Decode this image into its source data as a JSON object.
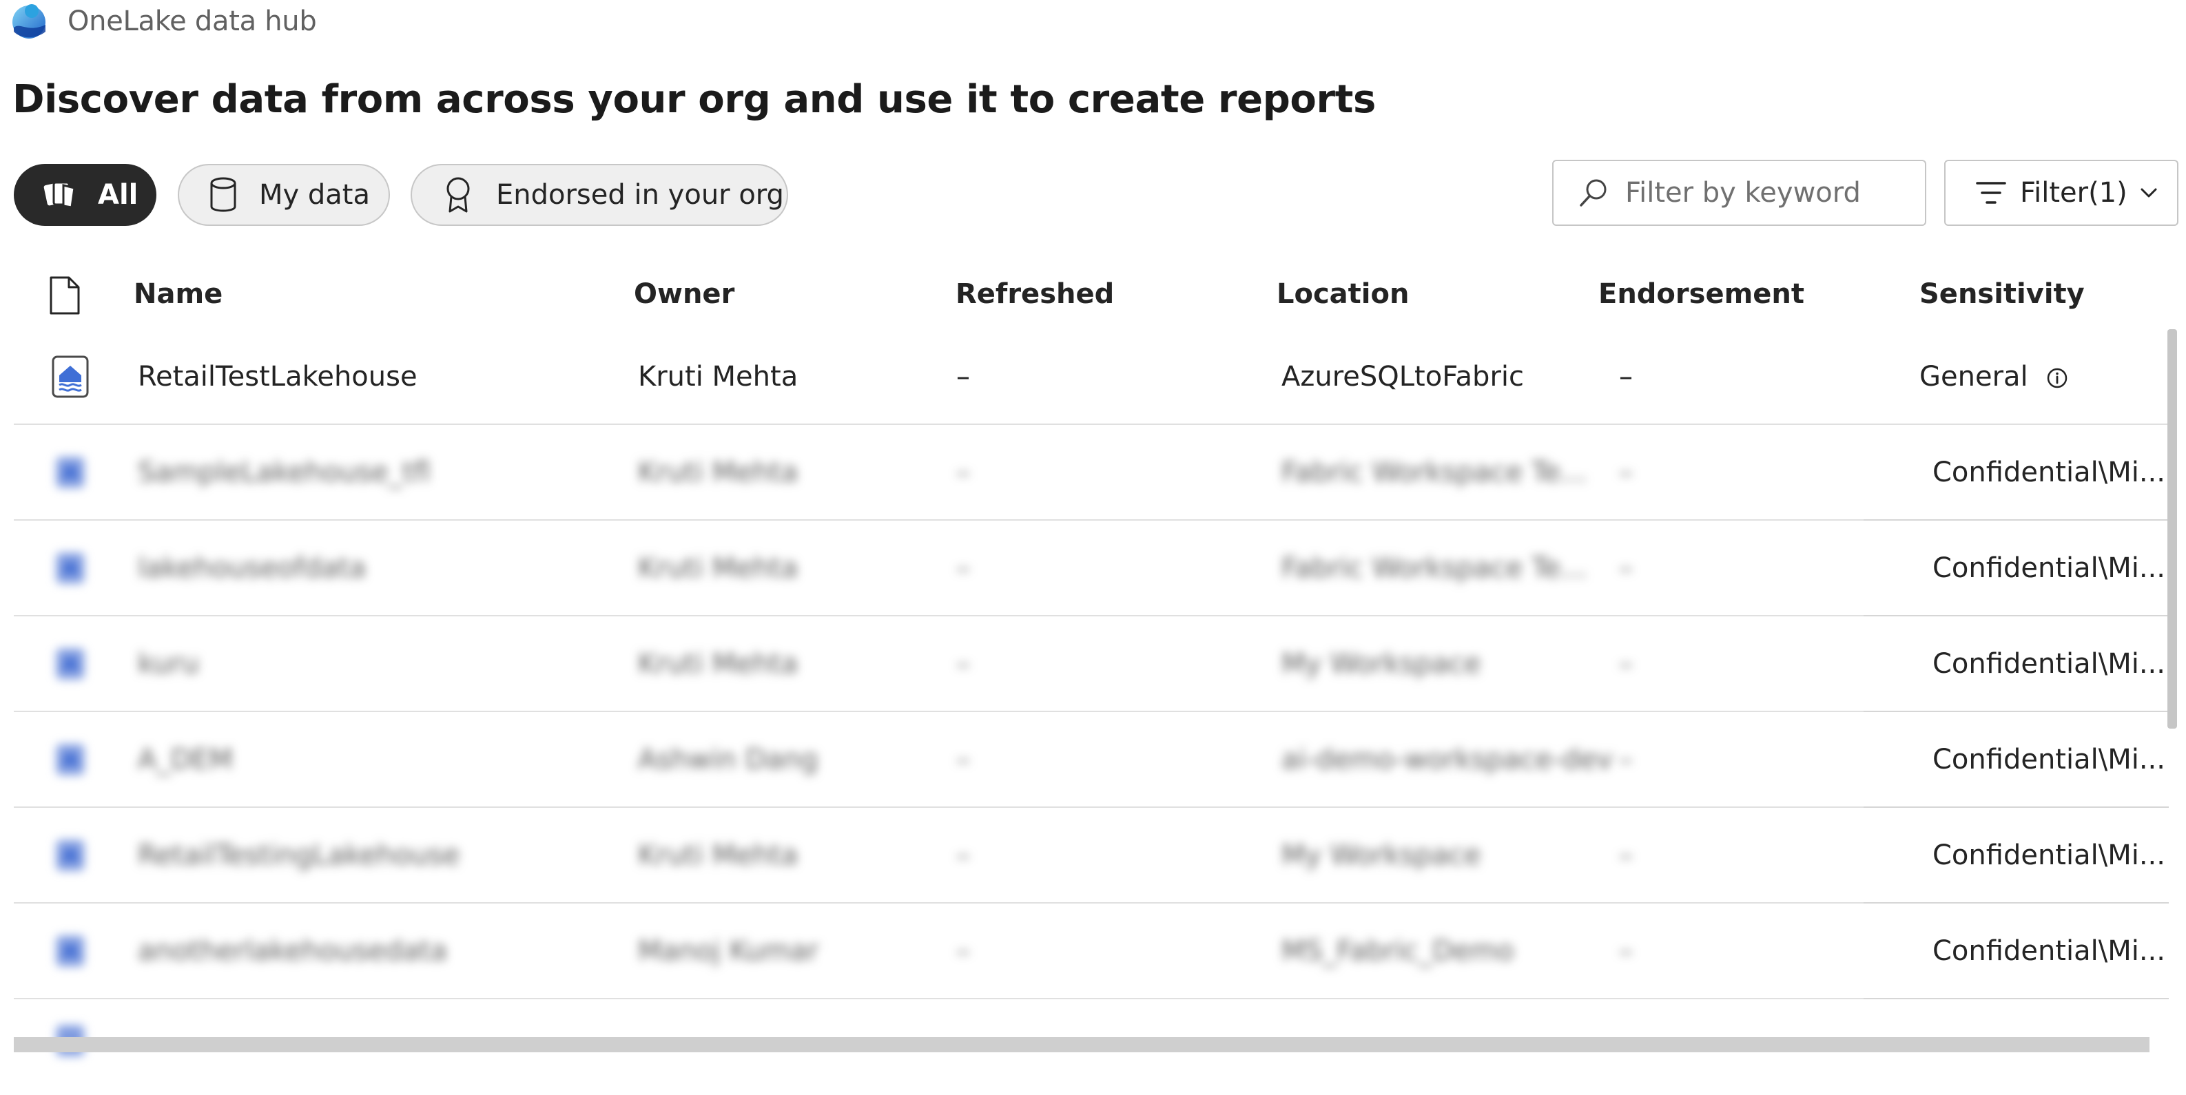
{
  "app": {
    "title": "OneLake data hub",
    "logo_icon": "onelake-logo-icon"
  },
  "page": {
    "title": "Discover data from across your org and use it to create reports"
  },
  "filters": {
    "chips": [
      {
        "label": "All",
        "icon": "all-items-icon",
        "selected": true
      },
      {
        "label": "My data",
        "icon": "database-icon",
        "selected": false
      },
      {
        "label": "Endorsed in your org",
        "icon": "ribbon-icon",
        "selected": false
      }
    ],
    "search_placeholder": "Filter by keyword",
    "filter_button_label": "Filter(1)"
  },
  "table": {
    "columns": [
      "Name",
      "Owner",
      "Refreshed",
      "Location",
      "Endorsement",
      "Sensitivity"
    ],
    "rows": [
      {
        "name": "RetailTestLakehouse",
        "owner": "Kruti Mehta",
        "refreshed": "–",
        "location": "AzureSQLtoFabric",
        "endorsement": "–",
        "sensitivity": "General",
        "blurred": false
      },
      {
        "name": "SampleLakehouse_tfl",
        "owner": "Kruti Mehta",
        "refreshed": "–",
        "location": "Fabric Workspace Te...",
        "endorsement": "–",
        "sensitivity": "Confidential\\Mi...",
        "blurred": true
      },
      {
        "name": "lakehouseofdata",
        "owner": "Kruti Mehta",
        "refreshed": "–",
        "location": "Fabric Workspace Te...",
        "endorsement": "–",
        "sensitivity": "Confidential\\Mi...",
        "blurred": true
      },
      {
        "name": "kuru",
        "owner": "Kruti Mehta",
        "refreshed": "–",
        "location": "My Workspace",
        "endorsement": "–",
        "sensitivity": "Confidential\\Mi...",
        "blurred": true
      },
      {
        "name": "A_DEM",
        "owner": "Ashwin Dang",
        "refreshed": "–",
        "location": "ai-demo-workspace-dev",
        "endorsement": "–",
        "sensitivity": "Confidential\\Mi...",
        "blurred": true
      },
      {
        "name": "RetailTestingLakehouse",
        "owner": "Kruti Mehta",
        "refreshed": "–",
        "location": "My Workspace",
        "endorsement": "–",
        "sensitivity": "Confidential\\Mi...",
        "blurred": true
      },
      {
        "name": "anotherlakehousedata",
        "owner": "Manoj Kumar",
        "refreshed": "–",
        "location": "MS_Fabric_Demo",
        "endorsement": "–",
        "sensitivity": "Confidential\\Mi...",
        "blurred": true
      }
    ]
  },
  "colors": {
    "chip_selected_bg": "#292929",
    "chip_bg": "#efefef",
    "icon_blue": "#3f6fd6"
  }
}
